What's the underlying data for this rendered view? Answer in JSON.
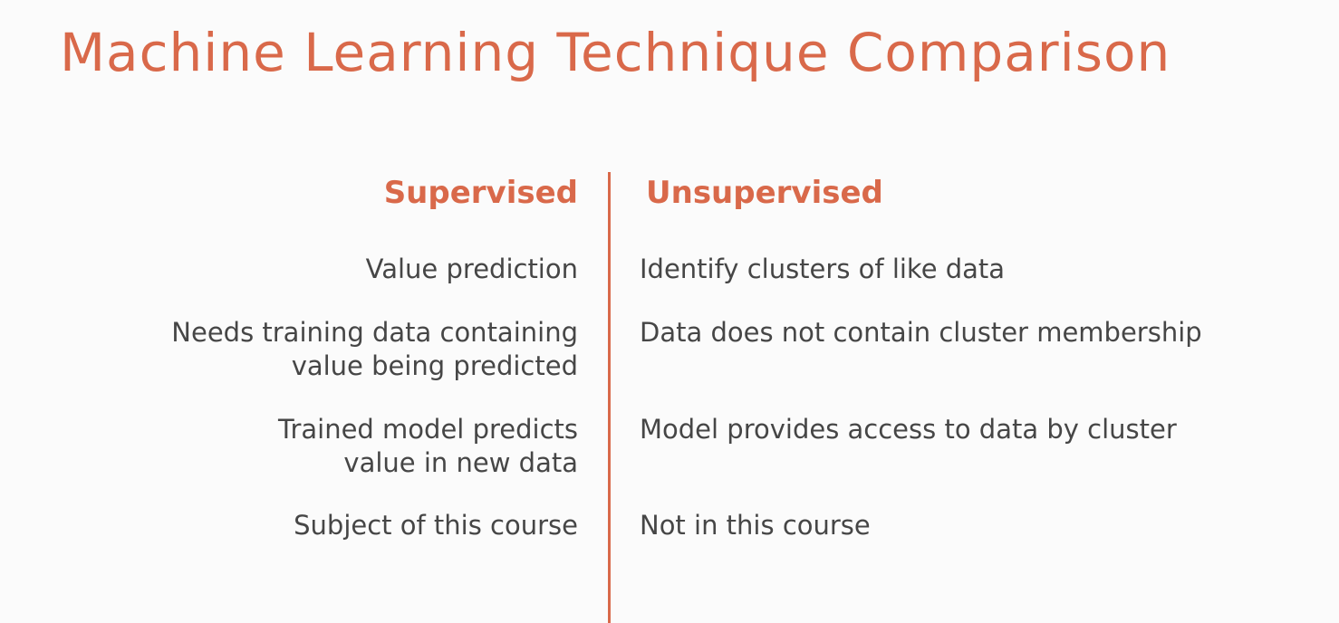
{
  "title": "Machine Learning Technique Comparison",
  "accent_color": "#d9694a",
  "columns": {
    "left_header": "Supervised",
    "right_header": "Unsupervised"
  },
  "rows": [
    {
      "supervised": [
        "Value prediction"
      ],
      "unsupervised": [
        "Identify clusters of like data"
      ]
    },
    {
      "supervised": [
        "Needs training data containing",
        "value being predicted"
      ],
      "unsupervised": [
        "Data does not contain cluster membership"
      ]
    },
    {
      "supervised": [
        "Trained model predicts",
        "value in new data"
      ],
      "unsupervised": [
        "Model provides access to data by cluster"
      ]
    },
    {
      "supervised": [
        "Subject of this course"
      ],
      "unsupervised": [
        "Not in this course"
      ]
    }
  ]
}
